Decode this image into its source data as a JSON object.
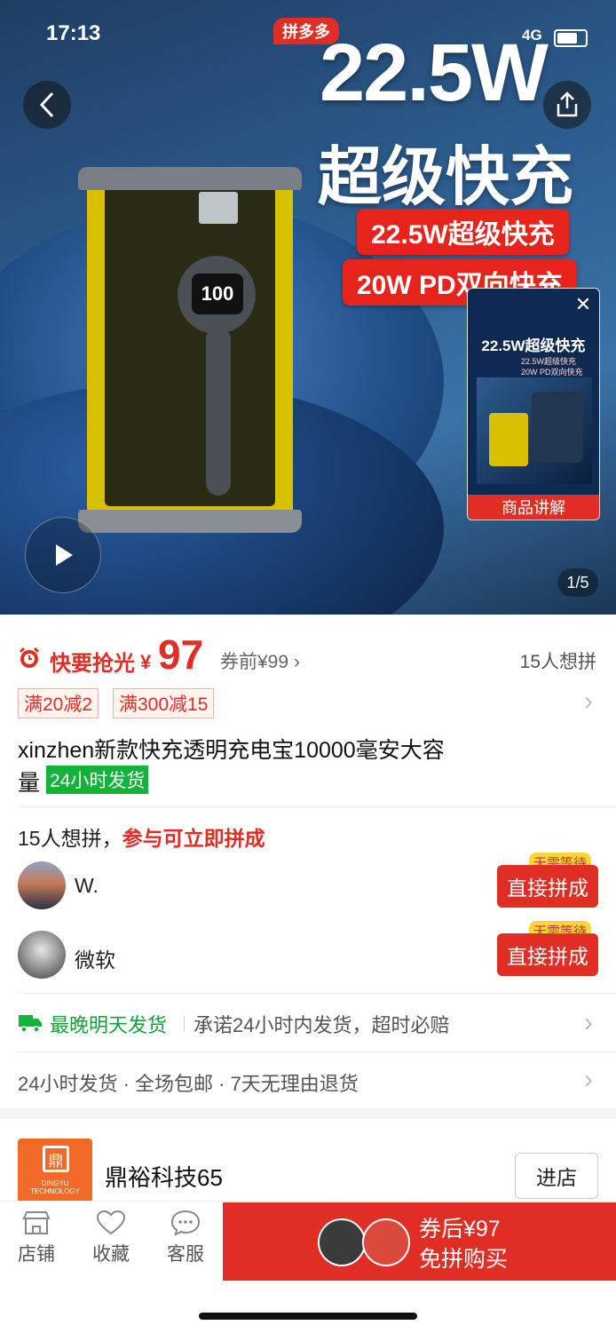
{
  "status_bar": {
    "time": "17:13",
    "network": "4G"
  },
  "hero": {
    "brand_badge": "拼多多",
    "headline_watt": "22.5W",
    "headline_text": "超级快充",
    "tag_1": "22.5W超级快充",
    "tag_2": "20W PD双向快充",
    "device_screen": "100",
    "pager": "1/5",
    "pip": {
      "heading": "22.5W超级快充",
      "sub_1": "22.5W超级快充",
      "sub_2": "20W PD双向快充",
      "label": "商品讲解"
    }
  },
  "price_block": {
    "urgent_label": "快要抢光",
    "currency": "¥",
    "price": "97",
    "original_price": "券前¥99",
    "want_count": "15人想拼"
  },
  "coupons": [
    "满20减2",
    "满300减15"
  ],
  "product": {
    "title_line_1": "xinzhen新款快充透明充电宝10000毫安大容",
    "title_line_2_prefix": "量",
    "shipping_badge": "24小时发货"
  },
  "group_buy": {
    "heading_count": "15人想拼，",
    "heading_action": "参与可立即拼成",
    "users": [
      {
        "name": "W.",
        "badge": "无需等待",
        "button": "直接拼成"
      },
      {
        "name": "微软",
        "badge": "无需等待",
        "button": "直接拼成"
      }
    ]
  },
  "shipping": {
    "latest": "最晚明天发货",
    "promise": "承诺24小时内发货，超时必赔",
    "services": "24小时发货 · 全场包邮 · 7天无理由退货"
  },
  "shop": {
    "logo_text": "DINGYU TECHNOLOGY",
    "name": "鼎裕科技65",
    "visit": "进店"
  },
  "bottom_bar": {
    "tabs": [
      {
        "label": "店铺",
        "icon": "store-icon"
      },
      {
        "label": "收藏",
        "icon": "heart-icon"
      },
      {
        "label": "客服",
        "icon": "chat-icon"
      }
    ],
    "buy_line_1": "券后¥97",
    "buy_line_2": "免拼购买"
  },
  "colors": {
    "accent": "#e02e24",
    "green": "#11b33a",
    "yellow_badge": "#ffd53a"
  }
}
